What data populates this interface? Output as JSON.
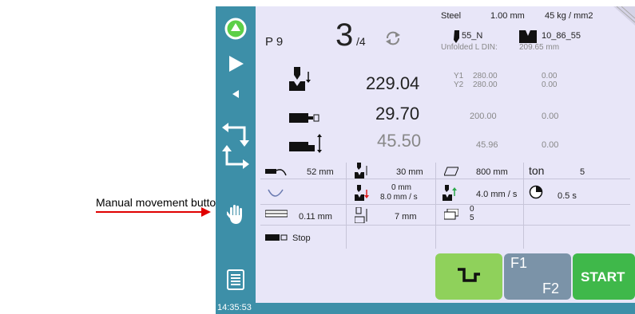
{
  "callout": {
    "text": "Manual movement button"
  },
  "clock": "14:35:53",
  "header": {
    "program": "P 9",
    "step": "3",
    "step_total": "/4",
    "material": "Steel",
    "thickness": "1.00 mm",
    "strength": "45 kg / mm2",
    "punch": "55_N",
    "die": "10_86_55",
    "unfolded_label": "Unfolded  L  DIN:",
    "unfolded_value": "209.65 mm"
  },
  "axes": {
    "y_value": "229.04",
    "y1_label": "Y1",
    "y1_value": "280.00",
    "y1_extra": "0.00",
    "y2_label": "Y2",
    "y2_value": "280.00",
    "y2_extra": "0.00",
    "x_value": "29.70",
    "x_ref": "200.00",
    "x_extra": "0.00",
    "r_value": "45.50",
    "r_ref": "45.96",
    "r_extra": "0.00"
  },
  "params": {
    "row1": {
      "a": "52 mm",
      "b": "30 mm",
      "c": "800 mm",
      "ton_label": "ton",
      "ton_value": "5"
    },
    "row2": {
      "b1": "0 mm",
      "b2": "8.0 mm / s",
      "c": "4.0 mm / s",
      "d": "0.5 s"
    },
    "row3": {
      "a": "0.11 mm",
      "b": "7 mm",
      "c1": "0",
      "c2": "5"
    },
    "row4": {
      "a": "Stop"
    }
  },
  "buttons": {
    "f1": "F1",
    "f2": "F2",
    "start": "START"
  },
  "colors": {
    "sidebar": "#3d8fa8",
    "panel": "#e8e6f8",
    "bend": "#8fd15b",
    "fkeys": "#7b93a8",
    "start": "#3fb84a",
    "callout": "#e00000"
  }
}
